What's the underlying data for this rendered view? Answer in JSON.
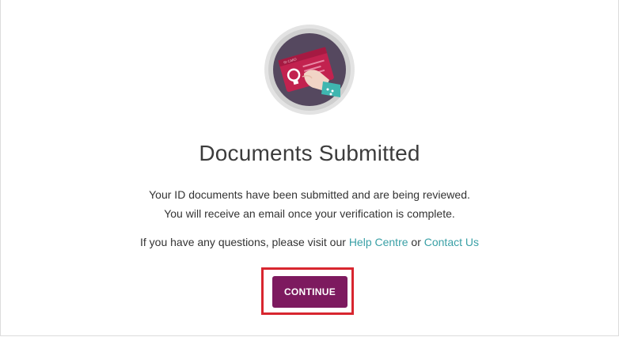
{
  "page": {
    "title": "Documents Submitted",
    "message_line1": "Your ID documents have been submitted and are being reviewed.",
    "message_line2": "You will receive an email once your verification is complete.",
    "questions_prefix": "If you have any questions, please visit our ",
    "help_centre_link": "Help Centre",
    "connector": " or ",
    "contact_us_link": "Contact Us",
    "continue_label": "CONTINUE"
  },
  "illustration": {
    "icon": "id-card-in-hand-icon",
    "card_text": "ID CARD",
    "colors": {
      "outer_ring": "#d9d9d9",
      "circle_bg": "#55485f",
      "card": "#c2224f",
      "sleeve": "#3fb6b0",
      "hand": "#f1d4c6"
    }
  },
  "colors": {
    "link": "#3aa0a6",
    "button": "#7d1a5f",
    "highlight": "#d8262f",
    "title": "#3c3c3c"
  }
}
